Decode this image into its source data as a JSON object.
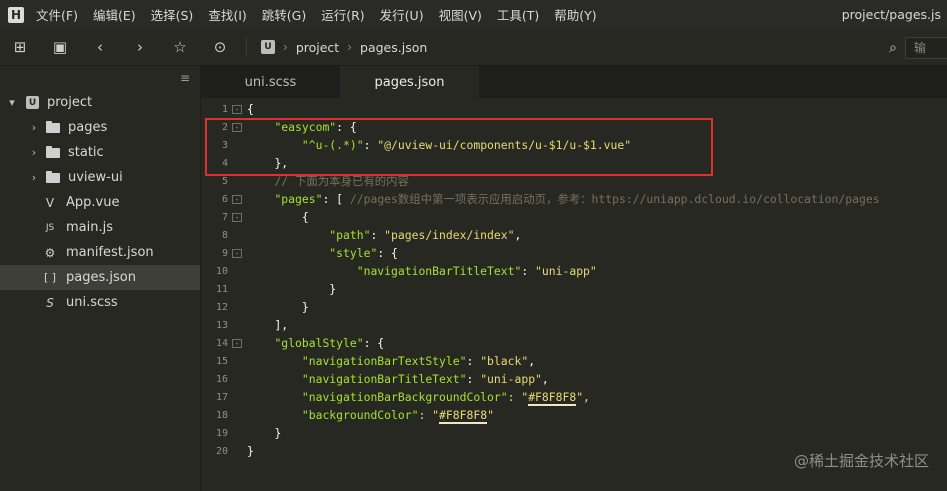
{
  "app": {
    "logo": "H",
    "window_title": "project/pages.js"
  },
  "menu": [
    "文件(F)",
    "编辑(E)",
    "选择(S)",
    "查找(I)",
    "跳转(G)",
    "运行(R)",
    "发行(U)",
    "视图(V)",
    "工具(T)",
    "帮助(Y)"
  ],
  "toolbar": {
    "breadcrumb_icon": "U",
    "breadcrumb": [
      "project",
      "pages.json"
    ],
    "input_placeholder": "输"
  },
  "sidebar": {
    "items": [
      {
        "label": "project",
        "type": "project",
        "arrow": "▾",
        "icon": "U"
      },
      {
        "label": "pages",
        "type": "folder",
        "arrow": "›"
      },
      {
        "label": "static",
        "type": "folder",
        "arrow": "›"
      },
      {
        "label": "uview-ui",
        "type": "folder",
        "arrow": "›"
      },
      {
        "label": "App.vue",
        "type": "file",
        "icon": "V"
      },
      {
        "label": "main.js",
        "type": "file",
        "icon": "JS"
      },
      {
        "label": "manifest.json",
        "type": "file",
        "icon": "⚙"
      },
      {
        "label": "pages.json",
        "type": "file",
        "icon": "[ ]",
        "selected": true
      },
      {
        "label": "uni.scss",
        "type": "file",
        "icon": "S"
      }
    ]
  },
  "tabs": [
    {
      "label": "uni.scss",
      "active": false
    },
    {
      "label": "pages.json",
      "active": true
    }
  ],
  "editor": {
    "lines": [
      {
        "n": "1",
        "fold": "-"
      },
      {
        "n": "2",
        "fold": "-"
      },
      {
        "n": "3",
        "fold": ""
      },
      {
        "n": "4",
        "fold": ""
      },
      {
        "n": "5",
        "fold": ""
      },
      {
        "n": "6",
        "fold": "-"
      },
      {
        "n": "7",
        "fold": "-"
      },
      {
        "n": "8",
        "fold": ""
      },
      {
        "n": "9",
        "fold": "-"
      },
      {
        "n": "10",
        "fold": ""
      },
      {
        "n": "11",
        "fold": ""
      },
      {
        "n": "12",
        "fold": ""
      },
      {
        "n": "13",
        "fold": ""
      },
      {
        "n": "14",
        "fold": "-"
      },
      {
        "n": "15",
        "fold": ""
      },
      {
        "n": "16",
        "fold": ""
      },
      {
        "n": "17",
        "fold": ""
      },
      {
        "n": "18",
        "fold": ""
      },
      {
        "n": "19",
        "fold": ""
      },
      {
        "n": "20",
        "fold": ""
      }
    ],
    "tokens": {
      "l1_brace": "{",
      "l2_key": "\"easycom\"",
      "l2_rest": ": {",
      "l3_key": "\"^u-(.*)\"",
      "l3_colon": ": ",
      "l3_val": "\"@/uview-ui/components/u-$1/u-$1.vue\"",
      "l4": "},",
      "l5_comment": "// 下面为本身已有的内容",
      "l6_key": "\"pages\"",
      "l6_rest": ": [ ",
      "l6_comment": "//pages数组中第一项表示应用启动页，参考：https://uniapp.dcloud.io/collocation/pages",
      "l7": "{",
      "l8_key": "\"path\"",
      "l8_colon": ": ",
      "l8_val": "\"pages/index/index\"",
      "l8_end": ",",
      "l9_key": "\"style\"",
      "l9_rest": ": {",
      "l10_key": "\"navigationBarTitleText\"",
      "l10_colon": ": ",
      "l10_val": "\"uni-app\"",
      "l11": "}",
      "l12": "}",
      "l13": "],",
      "l14_key": "\"globalStyle\"",
      "l14_rest": ": {",
      "l15_key": "\"navigationBarTextStyle\"",
      "l15_colon": ": ",
      "l15_val": "\"black\"",
      "l15_end": ",",
      "l16_key": "\"navigationBarTitleText\"",
      "l16_colon": ": ",
      "l16_val": "\"uni-app\"",
      "l16_end": ",",
      "l17_key": "\"navigationBarBackgroundColor\"",
      "l17_colon": ": \"",
      "l17_val": "#F8F8F8",
      "l17_end": "\",",
      "l18_key": "\"backgroundColor\"",
      "l18_colon": ": \"",
      "l18_val": "#F8F8F8",
      "l18_end": "\"",
      "l19": "}",
      "l20": "}"
    }
  },
  "watermark": "@稀土掘金技术社区",
  "colors": {
    "highlight_box": "#e0302a",
    "key": "#a6e22e",
    "string": "#e6db74",
    "comment": "#75715e"
  }
}
